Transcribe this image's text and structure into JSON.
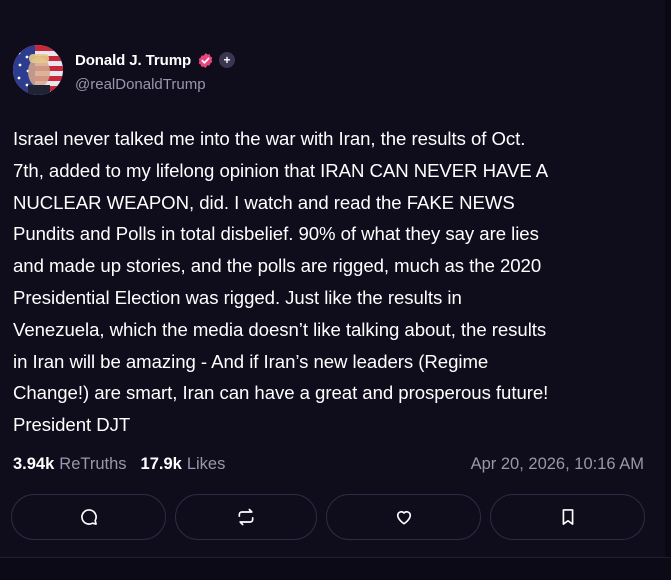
{
  "post": {
    "author": {
      "display_name": "Donald J. Trump",
      "handle": "@realDonaldTrump",
      "verified_icon": "verified-check-icon",
      "plus_badge": "+"
    },
    "text": "Israel never talked me into the war with Iran, the results of Oct.\n7th, added to my lifelong opinion that IRAN CAN NEVER HAVE A\nNUCLEAR WEAPON, did. I watch and read the FAKE NEWS\nPundits and Polls in total disbelief. 90% of what they say are lies\nand made up stories, and the polls are rigged, much as the 2020\nPresidential Election was rigged. Just like the results in\nVenezuela, which the media doesn’t like talking about, the results\nin Iran will be amazing - And if Iran’s new leaders (Regime\nChange!) are smart, Iran can have a great and prosperous future!\nPresident DJT",
    "stats": {
      "retruths_count": "3.94k",
      "retruths_label": "ReTruths",
      "likes_count": "17.9k",
      "likes_label": "Likes"
    },
    "timestamp": "Apr 20, 2026, 10:16 AM"
  },
  "actions": [
    {
      "name": "reply",
      "icon": "comment-icon"
    },
    {
      "name": "retruth",
      "icon": "repost-icon"
    },
    {
      "name": "like",
      "icon": "heart-icon"
    },
    {
      "name": "bookmark",
      "icon": "bookmark-icon"
    }
  ],
  "colors": {
    "background": "#0f0c1c",
    "text_primary": "#ffffff",
    "text_secondary": "#9a96ab",
    "button_border": "#2f2a45",
    "verified_badge": "#e8457f"
  }
}
